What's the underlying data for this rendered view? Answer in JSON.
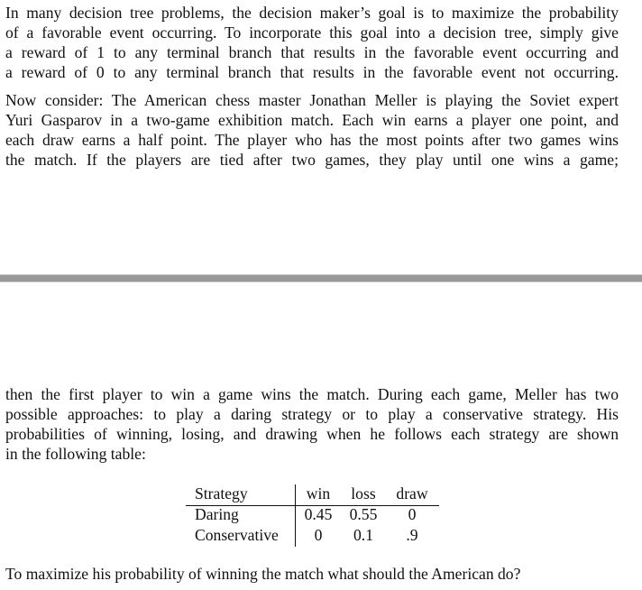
{
  "paragraph1": [
    "In many decision tree problems, the decision maker’s goal is to maximize the probability",
    "of a favorable event occurring. To incorporate this goal into a decision tree, simply give",
    "a reward of 1 to any terminal branch that results in the favorable event occurring and",
    "a reward of 0 to any terminal branch that results in the favorable event not occurring."
  ],
  "paragraph2": [
    "Now consider: The American chess master Jonathan Meller is playing the Soviet expert",
    "Yuri Gasparov in a two-game exhibition match. Each win earns a player one point, and",
    "each draw earns a half point. The player who has the most points after two games wins",
    "the match. If the players are tied after two games, they play until one wins a game;"
  ],
  "paragraph3": [
    "then the first player to win a game wins the match. During each game, Meller has two",
    "possible approaches: to play a daring strategy or to play a conservative strategy. His",
    "probabilities of winning, losing, and drawing when he follows each strategy are shown",
    "in the following table:"
  ],
  "table": {
    "headers": [
      "Strategy",
      "win",
      "loss",
      "draw"
    ],
    "rows": [
      [
        "Daring",
        "0.45",
        "0.55",
        "0"
      ],
      [
        "Conservative",
        "0",
        "0.1",
        ".9"
      ]
    ]
  },
  "question": "To maximize his probability of winning the match what should the American do?"
}
